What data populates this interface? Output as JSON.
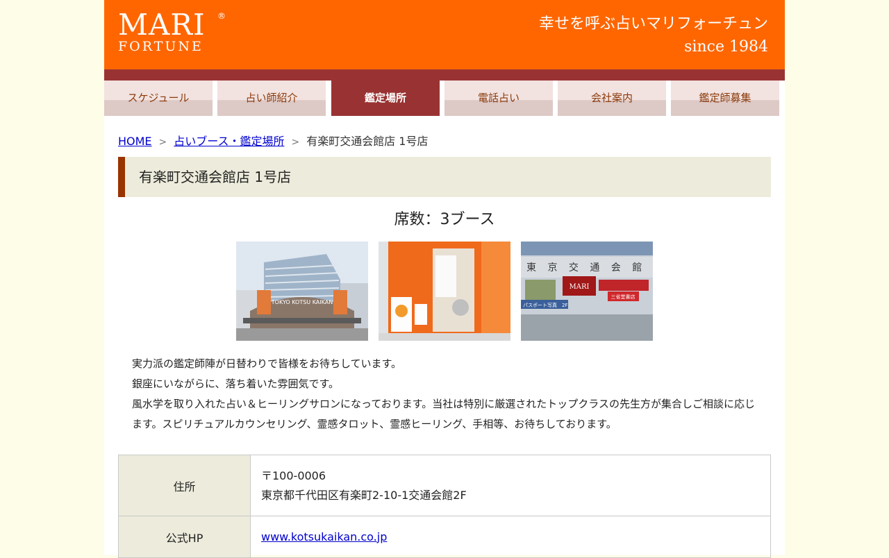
{
  "header": {
    "logo_main": "MARI",
    "logo_reg": "®",
    "logo_sub": "FORTUNE",
    "tagline_1": "幸せを呼ぶ占いマリフォーチュン",
    "tagline_2": "since 1984"
  },
  "nav": {
    "items": [
      {
        "label": "スケジュール"
      },
      {
        "label": "占い師紹介"
      },
      {
        "label": "鑑定場所"
      },
      {
        "label": "電話占い"
      },
      {
        "label": "会社案内"
      },
      {
        "label": "鑑定師募集"
      }
    ],
    "active_index": 2
  },
  "breadcrumb": {
    "home": "HOME",
    "sep": ">",
    "section": "占いブース・鑑定場所",
    "current": "有楽町交通会館店 1号店"
  },
  "page_title": "有楽町交通会館店 1号店",
  "seats": "席数：3ブース",
  "photos": {
    "p1_sign": "TOKYO KOTSU KAIKAN",
    "p3_sign": "東 京 交 通 会 館",
    "p3_brand": "MARI",
    "p3_shop": "三省堂書店",
    "p3_banner": "パスポート写真　2F"
  },
  "description": [
    "実力派の鑑定師陣が日替わりで皆様をお待ちしています。",
    "銀座にいながらに、落ち着いた雰囲気です。",
    "風水学を取り入れた占い＆ヒーリングサロンになっております。当社は特別に厳選されたトップクラスの先生方が集合しご相談に応じます。スピリチュアルカウンセリング、霊感タロット、霊感ヒーリング、手相等、お待ちしております。"
  ],
  "info": {
    "address_label": "住所",
    "postal": "〒100-0006",
    "address": "東京都千代田区有楽町2-10-1交通会館2F",
    "hp_label": "公式HP",
    "hp_url": "www.kotsukaikan.co.jp"
  },
  "colors": {
    "header_orange": "#ff6600",
    "band_maroon": "#993333",
    "title_bg": "#edecdc",
    "page_bg": "#fefde8"
  }
}
